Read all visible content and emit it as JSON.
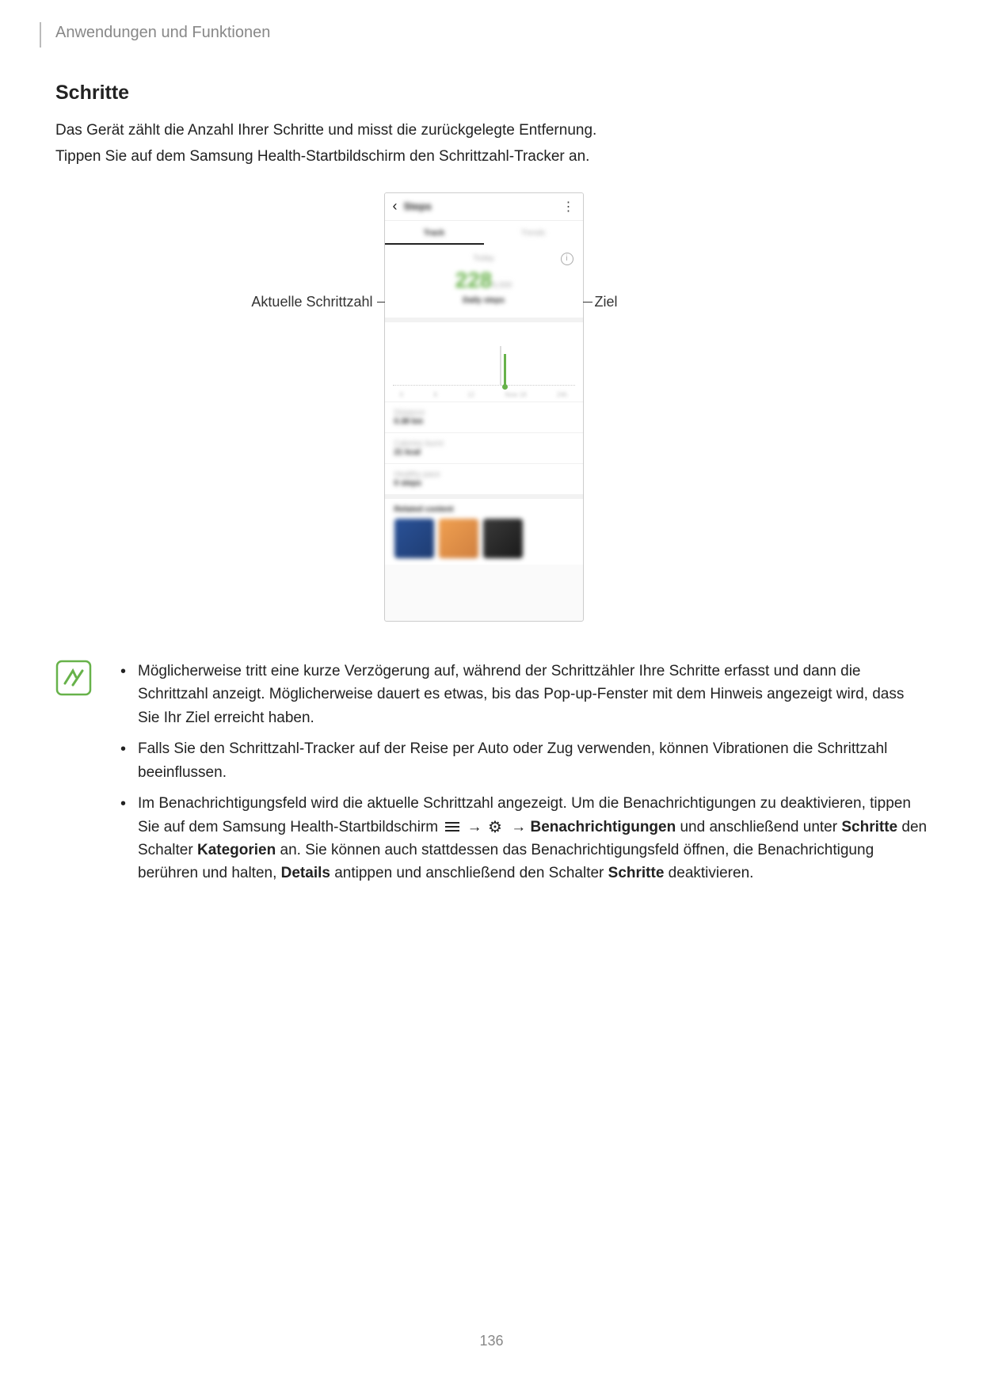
{
  "header": "Anwendungen und Funktionen",
  "h2": "Schritte",
  "para1": "Das Gerät zählt die Anzahl Ihrer Schritte und misst die zurückgelegte Entfernung.",
  "para2": "Tippen Sie auf dem Samsung Health-Startbildschirm den Schrittzahl-Tracker an.",
  "callout_left": "Aktuelle Schrittzahl",
  "callout_right": "Ziel",
  "phone": {
    "title": "Steps",
    "tab1": "Track",
    "tab2": "Trends",
    "today_label": "Today",
    "count": "228",
    "goal_label": "6,000",
    "goal_sublabel": "Daily steps",
    "stat1_label": "Distance",
    "stat1_value": "0.38 km",
    "stat2_label": "Calories burnt",
    "stat2_value": "21 kcal",
    "stat3_label": "Healthy pace",
    "stat3_value": "0 steps",
    "related_label": "Related content"
  },
  "notes": {
    "item1": "Möglicherweise tritt eine kurze Verzögerung auf, während der Schrittzähler Ihre Schritte erfasst und dann die Schrittzahl anzeigt. Möglicherweise dauert es etwas, bis das Pop-up-Fenster mit dem Hinweis angezeigt wird, dass Sie Ihr Ziel erreicht haben.",
    "item2": "Falls Sie den Schrittzahl-Tracker auf der Reise per Auto oder Zug verwenden, können Vibrationen die Schrittzahl beeinflussen.",
    "item3_a": "Im Benachrichtigungsfeld wird die aktuelle Schrittzahl angezeigt. Um die Benachrichtigungen zu deaktivieren, tippen Sie auf dem Samsung Health-Startbildschirm ",
    "item3_b": " → ",
    "item3_c": " → ",
    "item3_bold1": "Benachrichtigungen",
    "item3_d": " und anschließend unter ",
    "item3_bold2": "Schritte",
    "item3_e": " den Schalter ",
    "item3_bold3": "Kategorien",
    "item3_f": " an. Sie können auch stattdessen das Benachrichtigungsfeld öffnen, die Benachrichtigung berühren und halten, ",
    "item3_bold4": "Details",
    "item3_g": " antippen und anschließend den Schalter ",
    "item3_bold5": "Schritte",
    "item3_h": " deaktivieren."
  },
  "page_num": "136"
}
